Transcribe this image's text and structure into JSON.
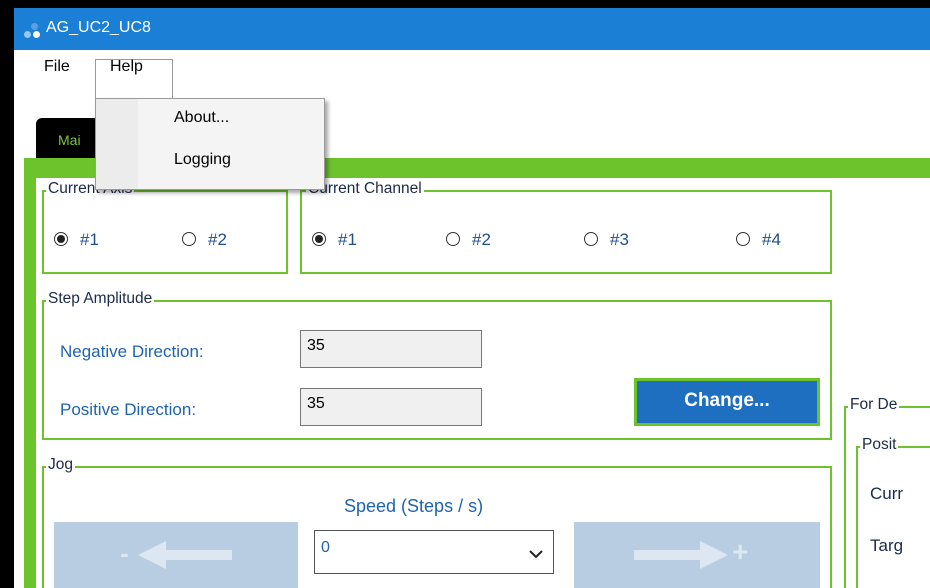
{
  "window": {
    "title": "AG_UC2_UC8"
  },
  "menu": {
    "file_label": "File",
    "help_label": "Help",
    "help_items": [
      "About...",
      "Logging"
    ]
  },
  "tabs": [
    {
      "label": "Mai"
    }
  ],
  "current_axis": {
    "label": "Current Axis",
    "options": [
      "#1",
      "#2"
    ],
    "selected": "#1"
  },
  "current_channel": {
    "label": "Current Channel",
    "options": [
      "#1",
      "#2",
      "#3",
      "#4"
    ],
    "selected": "#1"
  },
  "step_amplitude": {
    "label": "Step Amplitude",
    "negative_label": "Negative Direction:",
    "negative_value": "35",
    "positive_label": "Positive Direction:",
    "positive_value": "35",
    "change_label": "Change..."
  },
  "right_panel": {
    "for_label": "For De",
    "position_label": "Posit",
    "current_label": "Curr",
    "target_label": "Targ"
  },
  "jog": {
    "label": "Jog",
    "speed_label": "Speed (Steps / s)",
    "speed_value": "0",
    "minus_symbol": "-",
    "plus_symbol": "+"
  },
  "colors": {
    "title_bar": "#1c7fd6",
    "accent_green": "#6cc32c",
    "button_blue": "#1f6fc0",
    "jog_button": "#b9cde2",
    "label_blue": "#1f63b0"
  },
  "icons": {
    "app": "app-dots-icon",
    "jog_minus": "arrow-left-icon",
    "jog_plus": "arrow-right-icon",
    "dropdown": "chevron-down-icon"
  }
}
